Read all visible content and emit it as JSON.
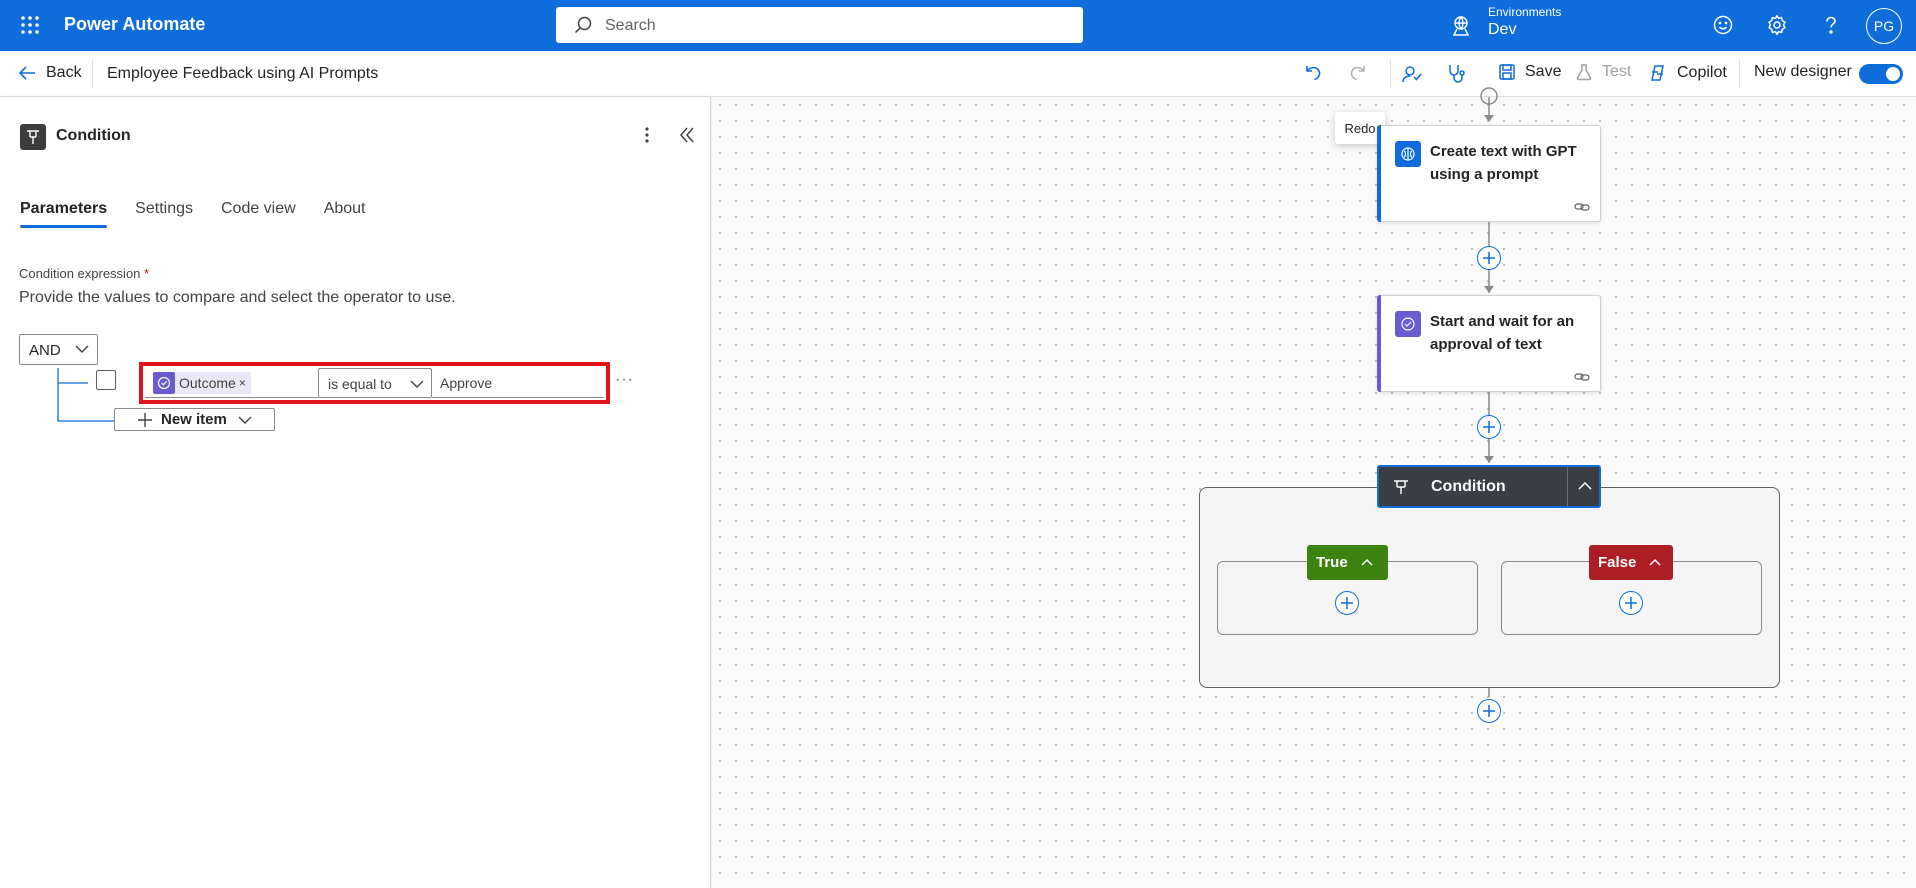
{
  "topbar": {
    "brand": "Power Automate",
    "search_placeholder": "Search",
    "env_label": "Environments",
    "env_value": "Dev",
    "avatar_initials": "PG",
    "bg_color": "#0f6cdb"
  },
  "commandbar": {
    "back_label": "Back",
    "flow_title": "Employee Feedback using AI Prompts",
    "save_label": "Save",
    "test_label": "Test",
    "copilot_label": "Copilot",
    "new_designer_label": "New designer",
    "new_designer_on": true
  },
  "panel": {
    "title": "Condition",
    "tabs": [
      {
        "label": "Parameters",
        "active": true
      },
      {
        "label": "Settings",
        "active": false
      },
      {
        "label": "Code view",
        "active": false
      },
      {
        "label": "About",
        "active": false
      }
    ],
    "condition_label": "Condition expression",
    "required_mark": "*",
    "condition_desc": "Provide the values to compare and select the operator to use.",
    "group_operator": "AND",
    "row": {
      "left_token": "Outcome",
      "token_remove": "×",
      "operator": "is equal to",
      "right_value": "Approve",
      "more": "···"
    },
    "new_item_label": "New item"
  },
  "canvas": {
    "tooltip": "Redo",
    "cards": [
      {
        "title": "Create text with GPT using a prompt",
        "accent": "#0f6cdb",
        "icon": "ai-builder-icon",
        "icon_bg": "#0f6cdb"
      },
      {
        "title": "Start and wait for an approval of text",
        "accent": "#6b5bd2",
        "icon": "approval-icon",
        "icon_bg": "#6b5bd2"
      }
    ],
    "condition": {
      "title": "Condition",
      "true_label": "True",
      "false_label": "False",
      "true_color": "#3d8310",
      "false_color": "#ad1d24"
    }
  }
}
